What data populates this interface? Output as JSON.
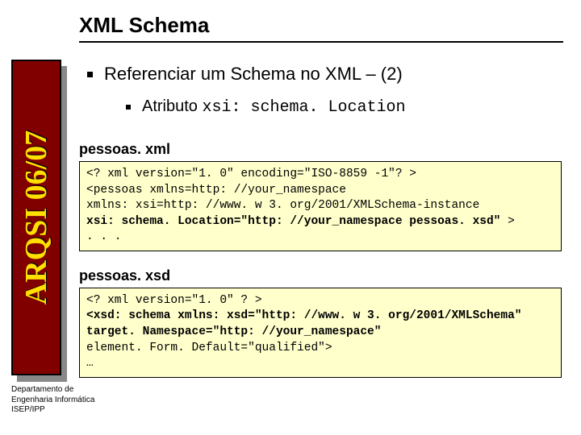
{
  "sidebar": {
    "text": "ARQSI 06/07"
  },
  "footer": {
    "line1": "Departamento de",
    "line2": "Engenharia Informática",
    "line3": "ISEP/IPP"
  },
  "title": "XML Schema",
  "bullet1_prefix": "Referenciar um Schema no XML",
  "bullet1_suffix": " – (2)",
  "bullet2_prefix": "Atributo ",
  "bullet2_code": "xsi: schema. Location",
  "code1": {
    "label": "pessoas. xml",
    "l1": "<? xml version=\"1. 0\" encoding=\"ISO-8859 -1\"? >",
    "l2": "<pessoas xmlns=http: //your_namespace",
    "l3": "xmlns: xsi=http: //www. w 3. org/2001/XMLSchema-instance",
    "l4a": "xsi: schema. Location=\"http: //your_namespace pessoas. xsd\"",
    "l4b": " >",
    "l5": ". . ."
  },
  "code2": {
    "label": "pessoas. xsd",
    "l1": "<? xml version=\"1. 0\" ? >",
    "l2": "<xsd: schema xmlns: xsd=\"http: //www. w 3. org/2001/XMLSchema\"",
    "l3": "target. Namespace=\"http: //your_namespace\"",
    "l4": "element. Form. Default=\"qualified\">",
    "l5": "…"
  }
}
